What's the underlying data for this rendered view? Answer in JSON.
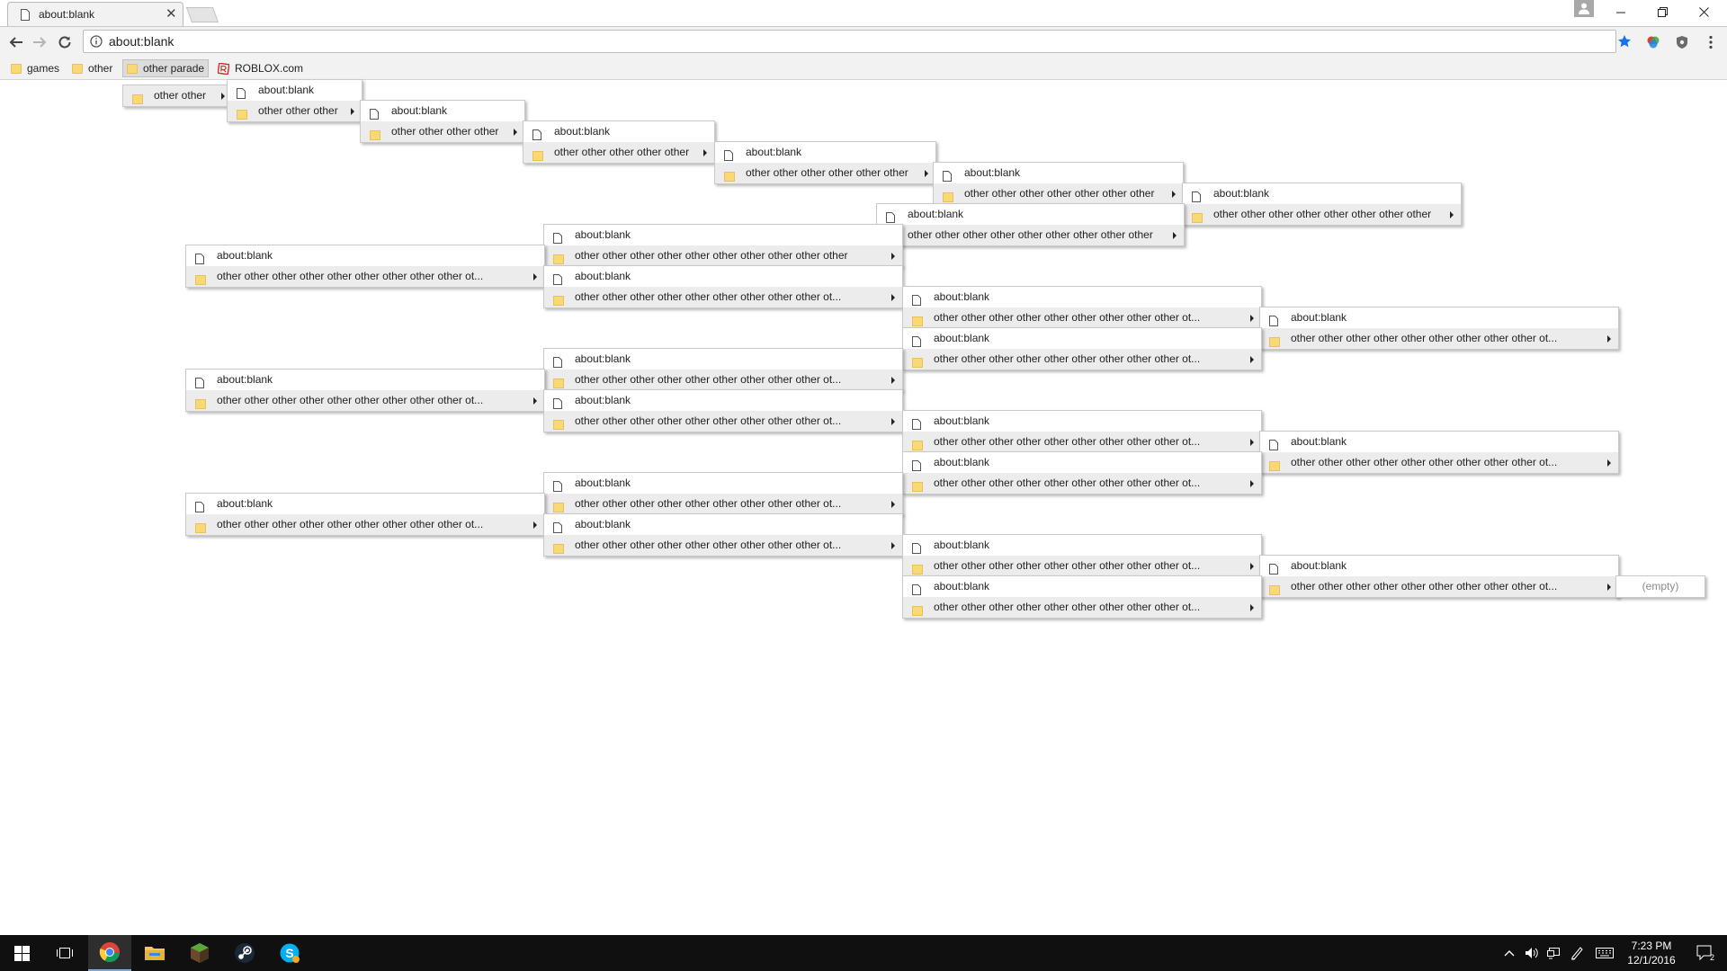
{
  "tab": {
    "title": "about:blank"
  },
  "omnibox": {
    "url": "about:blank"
  },
  "bookmarks": [
    {
      "label": "games",
      "type": "folder"
    },
    {
      "label": "other",
      "type": "folder"
    },
    {
      "label": "other parade",
      "type": "folder",
      "active": true
    },
    {
      "label": "ROBLOX.com",
      "type": "site"
    }
  ],
  "menus": [
    {
      "items": [
        {
          "type": "folder",
          "text": "other other",
          "sel": true
        }
      ]
    },
    {
      "items": [
        {
          "type": "page",
          "text": "about:blank"
        },
        {
          "type": "folder",
          "text": "other other other",
          "sel": true
        }
      ]
    },
    {
      "items": [
        {
          "type": "page",
          "text": "about:blank"
        },
        {
          "type": "folder",
          "text": "other other other other",
          "sel": true
        }
      ]
    },
    {
      "items": [
        {
          "type": "page",
          "text": "about:blank"
        },
        {
          "type": "folder",
          "text": "other other other other other",
          "sel": true
        }
      ]
    },
    {
      "items": [
        {
          "type": "page",
          "text": "about:blank"
        },
        {
          "type": "folder",
          "text": "other other other other other other",
          "sel": true
        }
      ]
    },
    {
      "items": [
        {
          "type": "page",
          "text": "about:blank"
        },
        {
          "type": "folder",
          "text": "other other other other other other other",
          "sel": true
        }
      ]
    },
    {
      "items": [
        {
          "type": "page",
          "text": "about:blank"
        },
        {
          "type": "folder",
          "text": "other other other other other other other other",
          "sel": true
        }
      ]
    },
    {
      "items": [
        {
          "type": "page",
          "text": "about:blank"
        },
        {
          "type": "folder",
          "text": "other other other other other other other other other",
          "sel": true
        }
      ]
    },
    {
      "items": [
        {
          "type": "page",
          "text": "about:blank"
        },
        {
          "type": "folder",
          "text": "other other other other other other other other other other",
          "sel": true
        }
      ]
    },
    {
      "items": [
        {
          "type": "page",
          "text": "about:blank"
        },
        {
          "type": "folder",
          "text": "other other other other other other other other other ot...",
          "sel": true
        }
      ]
    },
    {
      "items": [
        {
          "type": "page",
          "text": "about:blank"
        },
        {
          "type": "folder",
          "text": "other other other other other other other other other ot...",
          "sel": true
        }
      ]
    },
    {
      "items": [
        {
          "type": "page",
          "text": "about:blank"
        },
        {
          "type": "folder",
          "text": "other other other other other other other other other ot...",
          "sel": true
        }
      ]
    },
    {
      "items": [
        {
          "type": "page",
          "text": "about:blank"
        },
        {
          "type": "folder",
          "text": "other other other other other other other other other ot...",
          "sel": true
        }
      ]
    },
    {
      "items": [
        {
          "type": "page",
          "text": "about:blank"
        },
        {
          "type": "folder",
          "text": "other other other other other other other other other ot...",
          "sel": true
        }
      ]
    },
    {
      "items": [
        {
          "type": "page",
          "text": "about:blank"
        },
        {
          "type": "folder",
          "text": "other other other other other other other other other ot...",
          "sel": true
        }
      ]
    },
    {
      "items": [
        {
          "type": "page",
          "text": "about:blank"
        },
        {
          "type": "folder",
          "text": "other other other other other other other other other ot...",
          "sel": true
        }
      ]
    },
    {
      "items": [
        {
          "type": "page",
          "text": "about:blank"
        },
        {
          "type": "folder",
          "text": "other other other other other other other other other ot...",
          "sel": true
        }
      ]
    },
    {
      "items": [
        {
          "type": "page",
          "text": "about:blank"
        },
        {
          "type": "folder",
          "text": "other other other other other other other other other ot...",
          "sel": true
        }
      ]
    },
    {
      "items": [
        {
          "type": "page",
          "text": "about:blank"
        },
        {
          "type": "folder",
          "text": "other other other other other other other other other ot...",
          "sel": true
        }
      ]
    },
    {
      "items": [
        {
          "type": "page",
          "text": "about:blank"
        },
        {
          "type": "folder",
          "text": "other other other other other other other other other ot...",
          "sel": true
        }
      ]
    },
    {
      "items": [
        {
          "type": "page",
          "text": "about:blank"
        },
        {
          "type": "folder",
          "text": "other other other other other other other other other ot...",
          "sel": true
        }
      ]
    },
    {
      "items": [
        {
          "type": "page",
          "text": "about:blank"
        },
        {
          "type": "folder",
          "text": "other other other other other other other other other ot...",
          "sel": true
        }
      ]
    },
    {
      "items": [
        {
          "type": "page",
          "text": "about:blank"
        },
        {
          "type": "folder",
          "text": "other other other other other other other other other ot...",
          "sel": true
        }
      ]
    },
    {
      "items": [
        {
          "type": "page",
          "text": "about:blank"
        },
        {
          "type": "folder",
          "text": "other other other other other other other other other ot...",
          "sel": true
        }
      ]
    },
    {
      "items": [
        {
          "type": "page",
          "text": "about:blank"
        },
        {
          "type": "folder",
          "text": "other other other other other other other other other ot...",
          "sel": true
        }
      ]
    },
    {
      "items": [
        {
          "type": "page",
          "text": "about:blank"
        },
        {
          "type": "folder",
          "text": "other other other other other other other other other ot...",
          "sel": true
        }
      ]
    },
    {
      "items": [
        {
          "type": "empty",
          "text": "(empty)"
        }
      ]
    }
  ],
  "taskbar": {
    "items": [
      {
        "name": "start-button",
        "icon": "windows-logo-icon"
      },
      {
        "name": "task-view-button",
        "icon": "task-view-icon"
      },
      {
        "name": "chrome-taskbar-button",
        "icon": "chrome-icon",
        "active": true
      },
      {
        "name": "file-explorer-taskbar-button",
        "icon": "folder-icon"
      },
      {
        "name": "minecraft-taskbar-button",
        "icon": "minecraft-icon"
      },
      {
        "name": "steam-taskbar-button",
        "icon": "steam-icon"
      },
      {
        "name": "skype-taskbar-button",
        "icon": "skype-icon"
      }
    ],
    "time": "7:23 PM",
    "date": "12/1/2016",
    "notification_count": "2"
  },
  "colors": {
    "folder": "#f9d976",
    "taskbar": "#101010",
    "star": "#1a73e8"
  }
}
